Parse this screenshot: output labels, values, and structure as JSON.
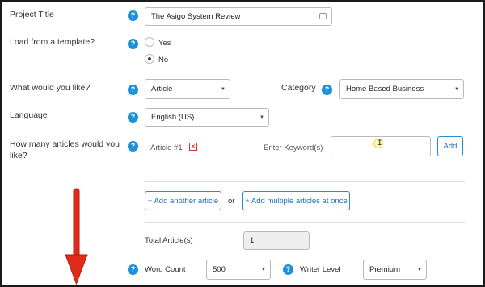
{
  "project_title": {
    "label": "Project Title",
    "value": "The Asigo System Review"
  },
  "template": {
    "label": "Load from a template?",
    "options": [
      "Yes",
      "No"
    ],
    "selected": "No"
  },
  "what_would_you_like": {
    "label": "What would you like?",
    "value": "Article"
  },
  "category": {
    "label": "Category",
    "value": "Home Based Business"
  },
  "language": {
    "label": "Language",
    "value": "English (US)"
  },
  "articles": {
    "label": "How many articles would you like?",
    "article_label": "Article #1",
    "keyword_label": "Enter Keyword(s)",
    "keyword_value": "",
    "add_label": "Add",
    "help_icon": "?"
  },
  "actions": {
    "add_another": "+ Add another article",
    "or": "or",
    "add_multiple": "+ Add multiple articles at once"
  },
  "total": {
    "label": "Total Article(s)",
    "value": "1"
  },
  "word_count": {
    "label": "Word Count",
    "value": "500"
  },
  "writer_level": {
    "label": "Writer Level",
    "value": "Premium"
  },
  "colors": {
    "accent": "#1e8fd8",
    "arrow": "#e02a1a",
    "remove": "#d9342b"
  }
}
